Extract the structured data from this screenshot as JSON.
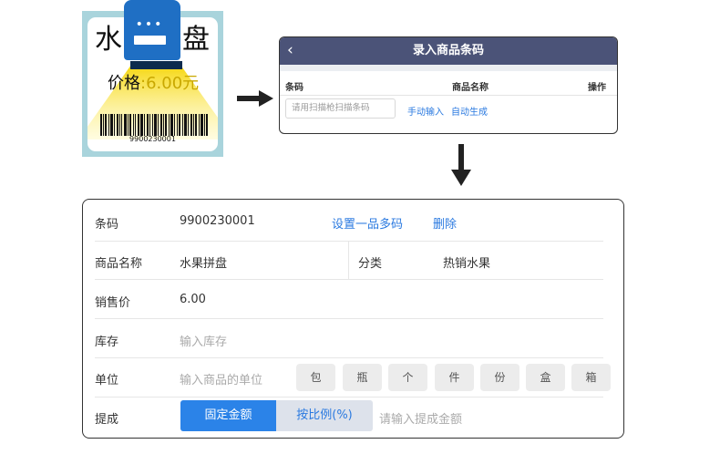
{
  "tag": {
    "char_left": "水",
    "char_right": "盘",
    "price_label": "价格",
    "price_value": ":6.00元",
    "barcode": "9900230001"
  },
  "top_panel": {
    "back": "‹",
    "title": "录入商品条码",
    "col_barcode": "条码",
    "col_name": "商品名称",
    "col_action": "操作",
    "input_placeholder": "请用扫描枪扫描条码",
    "manual_input": "手动输入",
    "auto_generate": "自动生成"
  },
  "form": {
    "barcode_label": "条码",
    "barcode_value": "9900230001",
    "multi_code_link": "设置一品多码",
    "delete_link": "删除",
    "name_label": "商品名称",
    "name_value": "水果拼盘",
    "category_label": "分类",
    "category_value": "热销水果",
    "price_label": "销售价",
    "price_value": "6.00",
    "stock_label": "库存",
    "stock_placeholder": "输入库存",
    "unit_label": "单位",
    "unit_placeholder": "输入商品的单位",
    "units": [
      "包",
      "瓶",
      "个",
      "件",
      "份",
      "盒",
      "箱"
    ],
    "commission_label": "提成",
    "commission_fixed": "固定金额",
    "commission_ratio": "按比例(%)",
    "commission_placeholder": "请输入提成金额"
  },
  "colors": {
    "accent": "#2b7ae0",
    "header": "#4b5378",
    "scanner": "#1f6fc4"
  }
}
